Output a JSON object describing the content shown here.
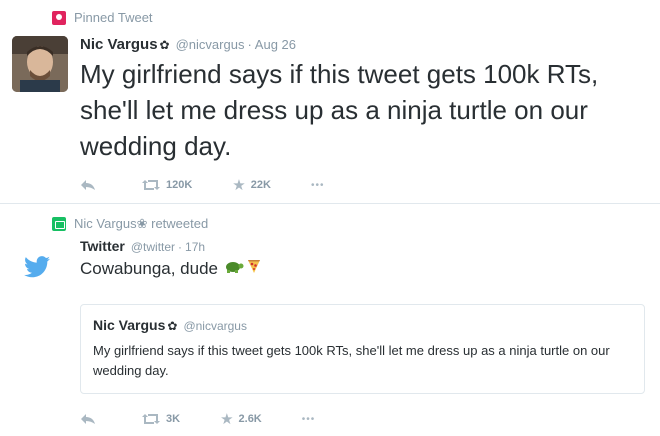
{
  "pinned_tweet": {
    "context_label": "Pinned Tweet",
    "author": {
      "name": "Nic Vargus",
      "handle": "@nicvargus",
      "time": "Aug 26"
    },
    "text": "My girlfriend says if this tweet gets 100k RTs, she'll let me dress up as a ninja turtle on our wedding day.",
    "actions": {
      "retweets": "120K",
      "favorites": "22K",
      "more": "•••"
    }
  },
  "retweeted_tweet": {
    "context_label": "Nic Vargus❀ retweeted",
    "author": {
      "name": "Twitter",
      "handle": "@twitter",
      "time": "17h"
    },
    "text": "Cowabunga, dude",
    "quoted": {
      "author": {
        "name": "Nic Vargus",
        "handle": "@nicvargus"
      },
      "text": "My girlfriend says if this tweet gets 100k RTs, she'll let me dress up as a ninja turtle on our wedding day."
    },
    "actions": {
      "retweets": "3K",
      "favorites": "2.6K",
      "more": "•••"
    }
  },
  "colors": {
    "twitter_blue": "#55acee",
    "retweet_green": "#17bf63",
    "pin_red": "#e0245e",
    "muted": "#8899a6"
  }
}
